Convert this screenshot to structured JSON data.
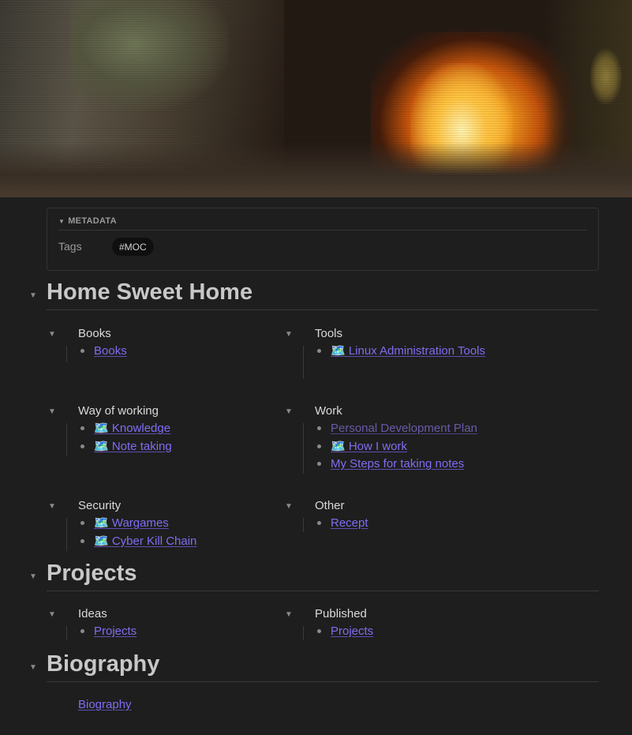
{
  "banner": {
    "description_icon": "fireplace-banner-image"
  },
  "metadata": {
    "header": "METADATA",
    "tags_label": "Tags",
    "tag": "#MOC"
  },
  "sections": {
    "home": {
      "title": "Home Sweet Home",
      "cards": {
        "books": {
          "title": "Books",
          "items": [
            "Books"
          ]
        },
        "tools": {
          "title": "Tools",
          "items": [
            "🗺️  Linux Administration Tools"
          ]
        },
        "way": {
          "title": "Way of working",
          "items": [
            "🗺️  Knowledge",
            "🗺️  Note taking"
          ]
        },
        "work": {
          "title": "Work",
          "items": [
            "Personal Development Plan",
            "🗺️  How I work",
            "My Steps for taking notes"
          ]
        },
        "security": {
          "title": "Security",
          "items": [
            "🗺️  Wargames",
            "🗺️  Cyber Kill Chain"
          ]
        },
        "other": {
          "title": "Other",
          "items": [
            "Recept"
          ]
        }
      }
    },
    "projects": {
      "title": "Projects",
      "cards": {
        "ideas": {
          "title": "Ideas",
          "items": [
            "Projects"
          ]
        },
        "published": {
          "title": "Published",
          "items": [
            "Projects"
          ]
        }
      }
    },
    "biography": {
      "title": "Biography",
      "link": "Biography"
    }
  },
  "colors": {
    "background": "#1e1e1e",
    "link": "#7f6df2",
    "heading": "#c8c8c8"
  }
}
